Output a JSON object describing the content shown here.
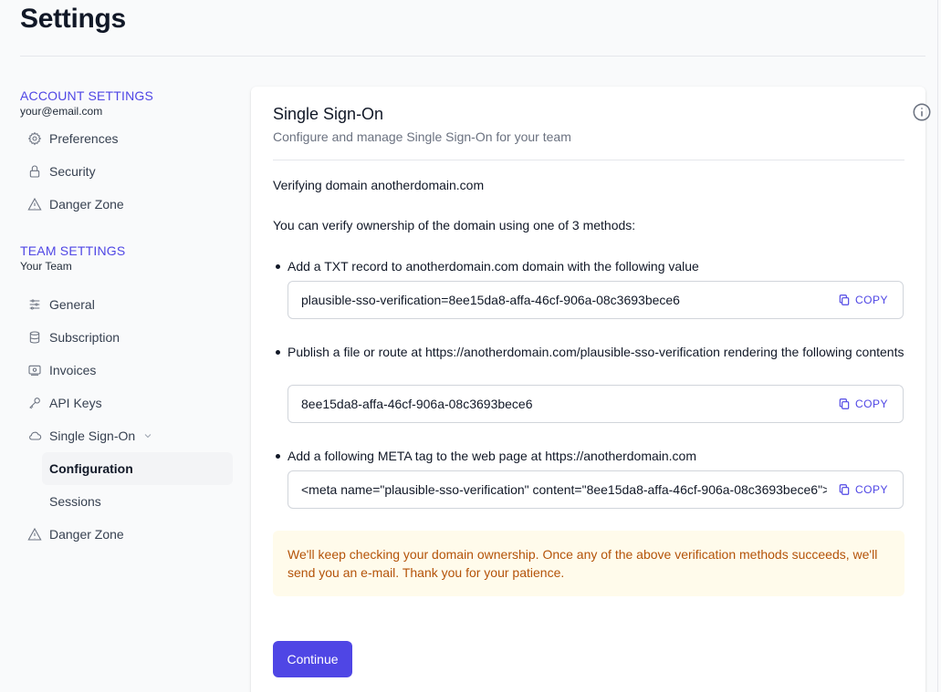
{
  "page": {
    "title": "Settings"
  },
  "sidebar": {
    "account": {
      "heading": "ACCOUNT SETTINGS",
      "subtitle": "your@email.com",
      "items": [
        {
          "label": "Preferences",
          "icon": "gear-icon"
        },
        {
          "label": "Security",
          "icon": "lock-icon"
        },
        {
          "label": "Danger Zone",
          "icon": "warning-icon"
        }
      ]
    },
    "team": {
      "heading": "TEAM SETTINGS",
      "subtitle": "Your Team",
      "items": [
        {
          "label": "General",
          "icon": "sliders-icon"
        },
        {
          "label": "Subscription",
          "icon": "database-icon"
        },
        {
          "label": "Invoices",
          "icon": "invoice-icon"
        },
        {
          "label": "API Keys",
          "icon": "key-icon"
        },
        {
          "label": "Single Sign-On",
          "icon": "cloud-icon",
          "expanded": true,
          "children": [
            {
              "label": "Configuration",
              "active": true
            },
            {
              "label": "Sessions",
              "active": false
            }
          ]
        },
        {
          "label": "Danger Zone",
          "icon": "warning-icon"
        }
      ]
    }
  },
  "card": {
    "title": "Single Sign-On",
    "description": "Configure and manage Single Sign-On for your team",
    "info_icon": "info-circle-icon",
    "verifying": "Verifying domain anotherdomain.com",
    "methods_intro": "You can verify ownership of the domain using one of 3 methods:",
    "methods": [
      {
        "text": "Add a TXT record to anotherdomain.com domain with the following value",
        "value": "plausible-sso-verification=8ee15da8-affa-46cf-906a-08c3693bece6",
        "copy_label": "COPY"
      },
      {
        "text": "Publish a file or route at https://anotherdomain.com/plausible-sso-verification rendering the following contents",
        "value": "8ee15da8-affa-46cf-906a-08c3693bece6",
        "copy_label": "COPY"
      },
      {
        "text": "Add a following META tag to the web page at https://anotherdomain.com",
        "value": "<meta name=\"plausible-sso-verification\" content=\"8ee15da8-affa-46cf-906a-08c3693bece6\">",
        "copy_label": "COPY"
      }
    ],
    "notice": "We'll keep checking your domain ownership. Once any of the above verification methods succeeds, we'll send you an e-mail. Thank you for your patience.",
    "continue_label": "Continue"
  },
  "colors": {
    "accent": "#4f46e5",
    "notice_bg": "#fffbeb",
    "notice_text": "#b45309"
  }
}
